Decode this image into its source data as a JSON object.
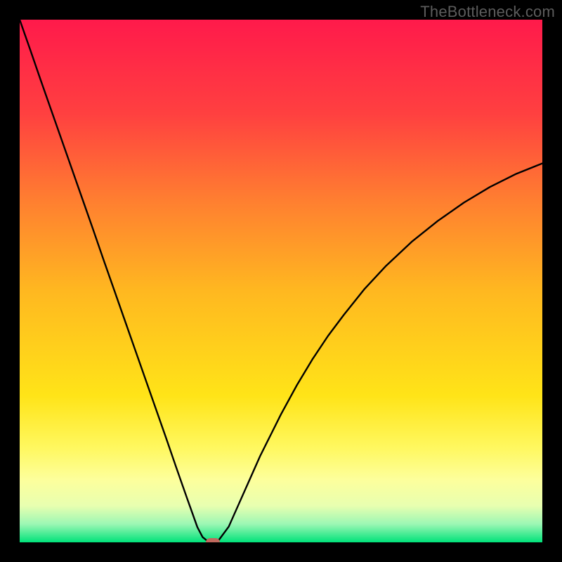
{
  "watermark": "TheBottleneck.com",
  "chart_data": {
    "type": "line",
    "title": "",
    "xlabel": "",
    "ylabel": "",
    "xlim": [
      0,
      100
    ],
    "ylim": [
      0,
      100
    ],
    "grid": false,
    "legend": false,
    "background_gradient_stops": [
      {
        "pos": 0.0,
        "color": "#ff1a4b"
      },
      {
        "pos": 0.18,
        "color": "#ff4040"
      },
      {
        "pos": 0.35,
        "color": "#ff8030"
      },
      {
        "pos": 0.52,
        "color": "#ffb820"
      },
      {
        "pos": 0.72,
        "color": "#ffe418"
      },
      {
        "pos": 0.82,
        "color": "#fff860"
      },
      {
        "pos": 0.88,
        "color": "#fdff9c"
      },
      {
        "pos": 0.93,
        "color": "#e8ffb0"
      },
      {
        "pos": 0.965,
        "color": "#9cf7b4"
      },
      {
        "pos": 1.0,
        "color": "#00e27a"
      }
    ],
    "series": [
      {
        "name": "bottleneck-curve",
        "stroke": "#000000",
        "stroke_width": 2.4,
        "x": [
          0,
          2,
          4,
          6,
          8,
          10,
          12,
          14,
          16,
          18,
          20,
          22,
          24,
          26,
          28,
          30,
          32,
          33,
          34,
          35,
          36,
          36.5,
          37,
          38,
          40,
          42,
          44,
          46,
          48,
          50,
          53,
          56,
          59,
          62,
          66,
          70,
          75,
          80,
          85,
          90,
          95,
          100
        ],
        "y": [
          100,
          94.3,
          88.5,
          82.8,
          77.1,
          71.4,
          65.7,
          60.0,
          54.2,
          48.5,
          42.8,
          37.1,
          31.4,
          25.7,
          20.0,
          14.2,
          8.5,
          5.7,
          2.9,
          1.0,
          0.2,
          0.0,
          0.0,
          0.3,
          3.0,
          7.5,
          12.0,
          16.5,
          20.5,
          24.5,
          30.0,
          35.0,
          39.5,
          43.5,
          48.5,
          52.8,
          57.5,
          61.5,
          65.0,
          68.0,
          70.5,
          72.5
        ]
      }
    ],
    "marker": {
      "x": 37.0,
      "y": 0.0,
      "color": "#c1695e"
    }
  }
}
